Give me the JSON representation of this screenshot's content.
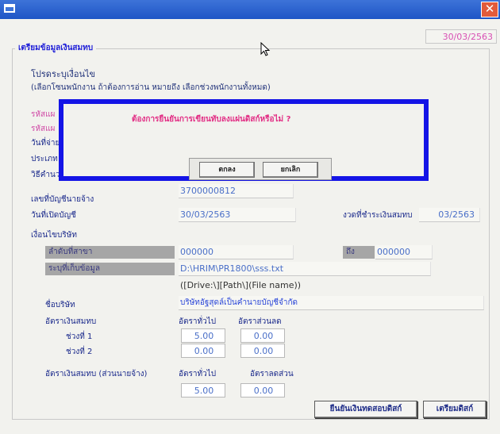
{
  "window": {
    "close_glyph": "✕",
    "date_display": "30/03/2563"
  },
  "group_title": "เตรียมข้อมูลเงินสมทบ",
  "instructions": {
    "line1": "โปรดระบุเงื่อนไข",
    "line2": "(เลือกโซนพนักงาน ถ้าต้องการอ่าน หมายถึง เลือกช่วงพนักงานทั้งหมด)"
  },
  "hidden_rows": {
    "row1": "รหัสแผ",
    "row2": "รหัสแผ",
    "row3": "วันที่จ่าย",
    "row4": "ประเภท",
    "row5": "วิธีคำนว"
  },
  "form": {
    "account_label": "เลขที่บัญชีนายจ้าง",
    "account_value": "3700000812",
    "open_date_label": "วันที่เปิดบัญชี",
    "open_date_value": "30/03/2563",
    "pay_period_label": "งวดที่ชำระเงินสมทบ",
    "pay_period_value": "03/2563",
    "company_condition_label": "เงื่อนไขบริษัท",
    "branch_label": "ลำดับที่สาขา",
    "branch_value": "000000",
    "to_label": "ถึง",
    "to_value": "000000",
    "path_label": "ระบุที่เก็บข้อมูล",
    "path_value": "D:\\HRIM\\PR1800\\sss.txt",
    "path_hint": "([Drive:\\][Path\\](File name))",
    "company_name_label": "ชื่อบริษัท",
    "company_name_value": "บริษัทอัฐสุดล์เป็นคำนายบัญชีจำกัด",
    "contrib_rate_label": "อัตราเงินสมทบ",
    "col_general": "อัตราทั่วไป",
    "col_reduced": "อัตราส่วนลด",
    "period1_label": "ช่วงที่ 1",
    "period1_general": "5.00",
    "period1_reduced": "0.00",
    "period2_label": "ช่วงที่ 2",
    "period2_general": "0.00",
    "period2_reduced": "0.00",
    "employer_rate_label": "อัตราเงินสมทบ (ส่วนนายจ้าง)",
    "col_general2": "อัตราทั่วไป",
    "col_reduced2": "อัตราลดส่วน",
    "employer_general": "5.00",
    "employer_reduced": "0.00"
  },
  "buttons": {
    "confirm_diskette": "ยืนยันเงินทดสอบดิสก์",
    "prepare_diskette": "เตรียมดิสก์"
  },
  "dialog": {
    "message": "ต้องการยืนยันการเขียนทับลงแผ่นดิสก์หรือไม่ ?",
    "ok_label": "ตกลง",
    "cancel_label": "ยกเลิก"
  }
}
